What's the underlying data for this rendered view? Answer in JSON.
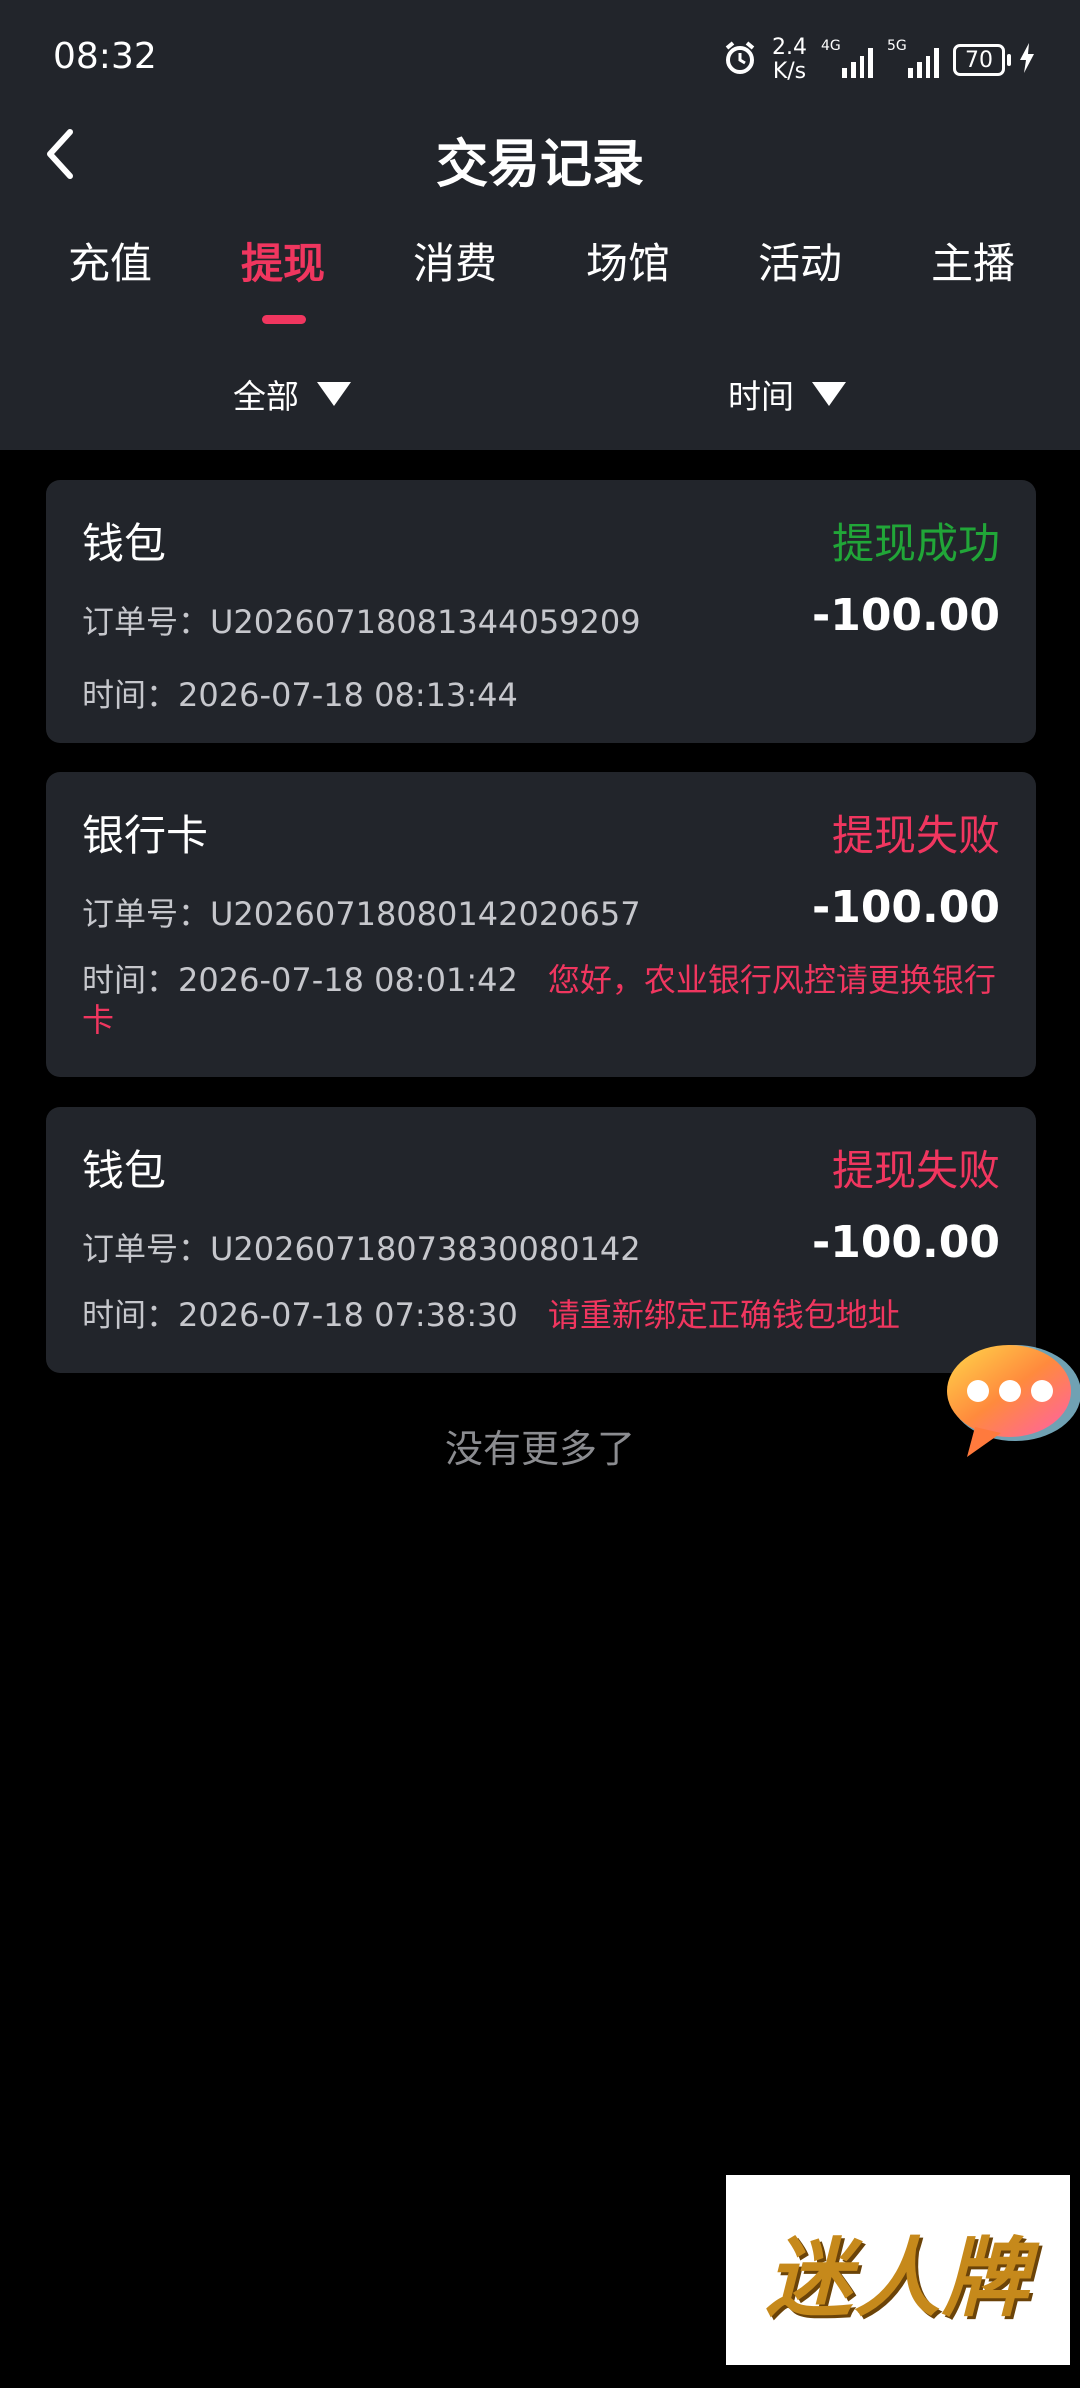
{
  "status_bar": {
    "time": "08:32",
    "net_speed_value": "2.4",
    "net_speed_unit": "K/s",
    "signal1_label": "4G",
    "signal2_label": "5G",
    "battery": "70"
  },
  "header": {
    "title": "交易记录"
  },
  "tabs": [
    {
      "label": "充值"
    },
    {
      "label": "提现"
    },
    {
      "label": "消费"
    },
    {
      "label": "场馆"
    },
    {
      "label": "活动"
    },
    {
      "label": "主播"
    }
  ],
  "filters": {
    "type": "全部",
    "time": "时间"
  },
  "records": [
    {
      "type": "钱包",
      "status": "提现成功",
      "order": "订单号：U20260718081344059209",
      "amount": "-100.00",
      "time": "时间：2026-07-18 08:13:44",
      "note": ""
    },
    {
      "type": "银行卡",
      "status": "提现失败",
      "order": "订单号：U20260718080142020657",
      "amount": "-100.00",
      "time": "时间：2026-07-18 08:01:42",
      "note": "您好，农业银行风控请更换银行卡"
    },
    {
      "type": "钱包",
      "status": "提现失败",
      "order": "订单号：U20260718073830080142",
      "amount": "-100.00",
      "time": "时间：2026-07-18 07:38:30",
      "note": "请重新绑定正确钱包地址"
    }
  ],
  "footer": {
    "no_more": "没有更多了"
  },
  "watermark": {
    "text": "迷人牌"
  },
  "colors": {
    "accent": "#f0365f",
    "success": "#21a638",
    "card_bg": "#22252b",
    "page_bg": "#000000"
  }
}
